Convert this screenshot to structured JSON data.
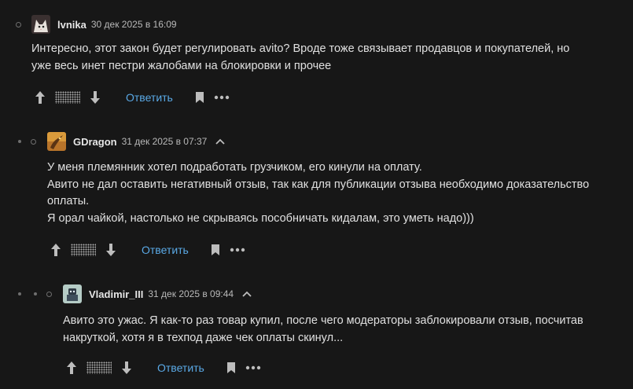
{
  "comments": [
    {
      "username": "lvnika",
      "date": "30 дек 2025 в 16:09",
      "text": "Интересно, этот закон будет регулировать avito? Вроде тоже связывает продавцов и покупателей, но\nуже весь инет пестри жалобами на блокировки и прочее",
      "reply_label": "Ответить",
      "avatar_icon": "avatar-cat-icon"
    },
    {
      "username": "GDragon",
      "date": "31 дек 2025 в 07:37",
      "text": "У меня племянник хотел подработать грузчиком, его кинули на оплату.\nАвито не дал оставить негативный отзыв, так как для публикации отзыва необходимо доказательство\nоплаты.\nЯ орал чайкой, настолько не скрываясь пособничать кидалам, это уметь надо)))",
      "reply_label": "Ответить",
      "avatar_icon": "avatar-dragon-icon"
    },
    {
      "username": "Vladimir_III",
      "date": "31 дек 2025 в 09:44",
      "text": "Авито это ужас. Я как-то раз товар купил, после чего модераторы заблокировали отзыв, посчитав\nнакруткой, хотя я в техпод даже чек оплаты скинул...",
      "reply_label": "Ответить",
      "avatar_icon": "avatar-robot-icon"
    }
  ],
  "colors": {
    "background": "#171717",
    "text": "#e0e0e0",
    "link": "#5aa9e6",
    "muted": "#6f6f6f"
  }
}
